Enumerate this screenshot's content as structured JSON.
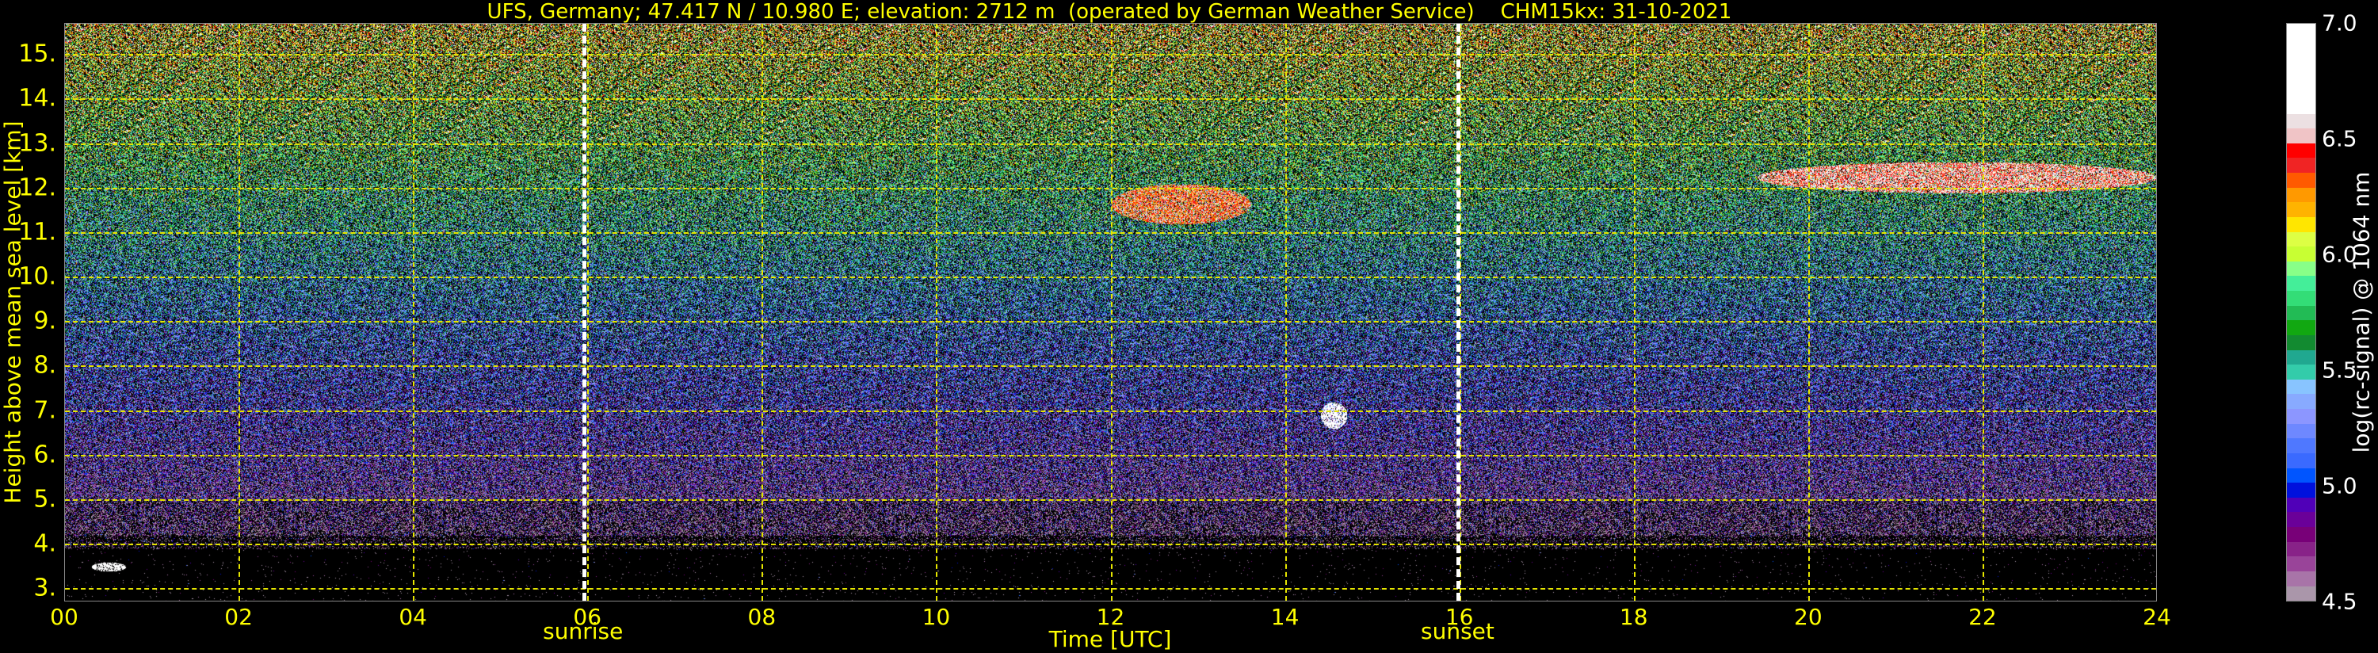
{
  "chart_data": {
    "type": "heatmap",
    "title": "UFS, Germany; 47.417 N / 10.980 E; elevation: 2712 m  (operated by German Weather Service)    CHM15kx: 31-10-2021",
    "xlabel": "Time [UTC]",
    "ylabel": "Height above mean sea level [km]",
    "xlim": [
      0,
      24
    ],
    "ylim": [
      2.7,
      15.7
    ],
    "x_ticks": [
      0,
      2,
      4,
      6,
      8,
      10,
      12,
      14,
      16,
      18,
      20,
      22,
      24
    ],
    "x_tick_labels": [
      "00",
      "02",
      "04",
      "06",
      "08",
      "10",
      "12",
      "14",
      "16",
      "18",
      "20",
      "22",
      "24"
    ],
    "y_ticks": [
      3,
      4,
      5,
      6,
      7,
      8,
      9,
      10,
      11,
      12,
      13,
      14,
      15
    ],
    "y_tick_labels": [
      "3.",
      "4.",
      "5.",
      "6.",
      "7.",
      "8.",
      "9.",
      "10.",
      "11.",
      "12.",
      "13.",
      "14.",
      "15."
    ],
    "grid": true,
    "events": [
      {
        "name": "sunrise",
        "time": 5.95
      },
      {
        "name": "sunset",
        "time": 15.98
      }
    ],
    "colorbar": {
      "label": "log(rc-signal) @ 1064 nm",
      "range": [
        4.5,
        7.0
      ],
      "ticks": [
        4.5,
        5.0,
        5.5,
        6.0,
        6.5,
        7.0
      ],
      "tick_labels": [
        "4.5",
        "5.0",
        "5.5",
        "6.0",
        "6.5",
        "7.0"
      ],
      "colors_top_to_bottom": [
        "#ffffff",
        "#ece0e2",
        "#f0c4c6",
        "#ff0000",
        "#f02424",
        "#ff5a00",
        "#ff9900",
        "#ffb300",
        "#ffe600",
        "#ddff44",
        "#c8ff33",
        "#88ff88",
        "#44ee99",
        "#33dd77",
        "#22bb55",
        "#11a811",
        "#128a30",
        "#20a890",
        "#33ccaa",
        "#88c4ff",
        "#88aaff",
        "#8c96ff",
        "#6e88ff",
        "#4f78ff",
        "#3a6aff",
        "#0055ff",
        "#0011dd",
        "#5000b8",
        "#6a0099",
        "#780078",
        "#882288",
        "#994499",
        "#a874a8",
        "#aa96aa"
      ]
    },
    "features": [
      {
        "desc": "low cloud",
        "time": [
          0.3,
          0.7
        ],
        "height_km": [
          3.4,
          3.6
        ],
        "value": 7.0
      },
      {
        "desc": "cirrus",
        "time": [
          19.4,
          24
        ],
        "height_km": [
          11.9,
          12.6
        ],
        "value": 6.5
      },
      {
        "desc": "cirrus",
        "time": [
          12.0,
          13.6
        ],
        "height_km": [
          11.2,
          12.1
        ],
        "value": 6.4
      },
      {
        "desc": "cloud",
        "time": [
          14.4,
          14.7
        ],
        "height_km": [
          6.6,
          7.2
        ],
        "value": 7.0
      }
    ]
  }
}
